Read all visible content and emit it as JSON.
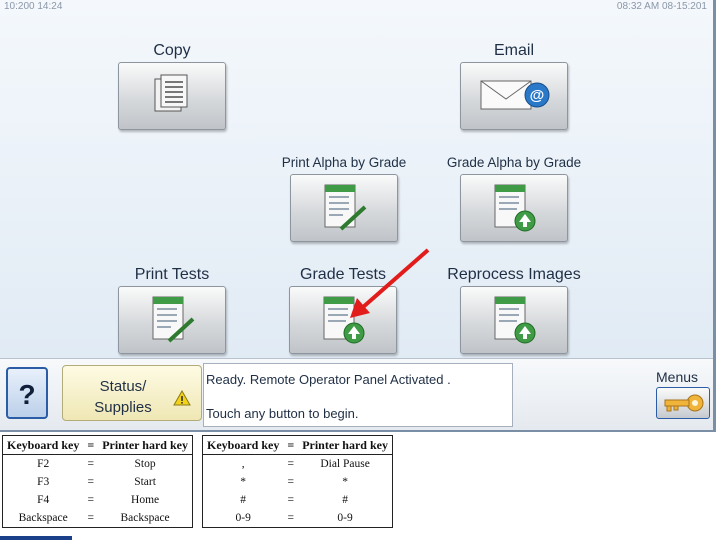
{
  "header": {
    "left_text": "10:200 14:24",
    "right_text": "08:32 AM 08-15:201"
  },
  "tiles": [
    {
      "label": "Copy",
      "icon": "copy-icon"
    },
    {
      "label": "Email",
      "icon": "email-icon"
    },
    {
      "label": "Print Alpha by Grade",
      "icon": "print-sheet-icon"
    },
    {
      "label": "Grade Alpha by Grade",
      "icon": "grade-sheet-icon"
    },
    {
      "label": "Print Tests",
      "icon": "print-sheet-icon"
    },
    {
      "label": "Grade Tests",
      "icon": "grade-sheet-icon"
    },
    {
      "label": "Reprocess Images",
      "icon": "grade-sheet-icon"
    }
  ],
  "bottom": {
    "help_label": "?",
    "status_line1": "Status/",
    "status_line2": "Supplies",
    "message_line1": "Ready. Remote Operator Panel Activated .",
    "message_line2": "Touch any button to begin.",
    "menus_label": "Menus"
  },
  "keyboard_tables": [
    {
      "header": [
        "Keyboard key",
        "=",
        "Printer hard key"
      ],
      "rows": [
        [
          "F2",
          "=",
          "Stop"
        ],
        [
          "F3",
          "=",
          "Start"
        ],
        [
          "F4",
          "=",
          "Home"
        ],
        [
          "Backspace",
          "=",
          "Backspace"
        ]
      ]
    },
    {
      "header": [
        "Keyboard key",
        "=",
        "Printer hard key"
      ],
      "rows": [
        [
          ",",
          "=",
          "Dial Pause"
        ],
        [
          "*",
          "=",
          "*"
        ],
        [
          "#",
          "=",
          "#"
        ],
        [
          "0-9",
          "=",
          "0-9"
        ]
      ]
    }
  ],
  "colors": {
    "accent_blue": "#2a5da6",
    "sheet_green": "#3f9b45",
    "arrow_red": "#e21b1b",
    "warning_yellow": "#f3d21c"
  }
}
